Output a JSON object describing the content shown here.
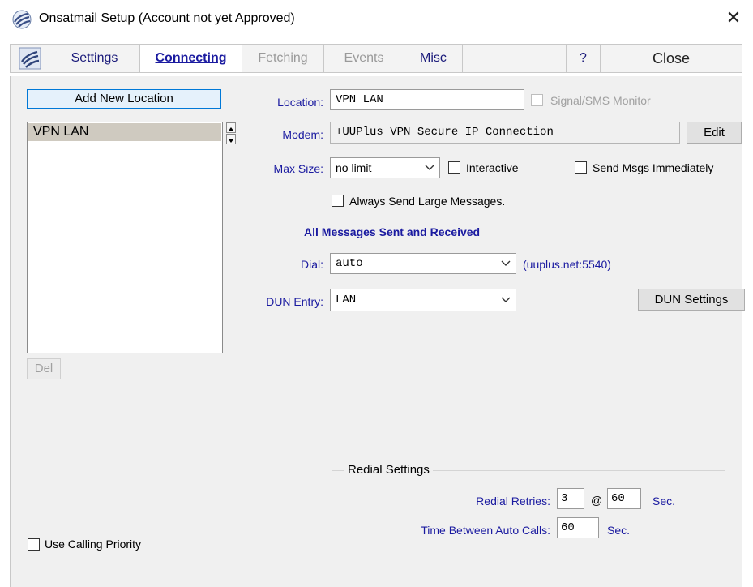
{
  "window": {
    "title": "Onsatmail Setup  (Account not yet Approved)",
    "close_glyph": "✕"
  },
  "tabs": [
    {
      "label": "Settings",
      "state": "normal"
    },
    {
      "label": "Connecting",
      "state": "active"
    },
    {
      "label": "Fetching",
      "state": "disabled"
    },
    {
      "label": "Events",
      "state": "disabled"
    },
    {
      "label": "Misc",
      "state": "normal"
    },
    {
      "label": "",
      "state": "blank"
    },
    {
      "label": "?",
      "state": "normal"
    },
    {
      "label": "Close",
      "state": "normal"
    }
  ],
  "locations": {
    "add_button": "Add New Location",
    "items": [
      "VPN LAN"
    ],
    "delete_button": "Del",
    "use_calling_priority": "Use Calling Priority"
  },
  "form": {
    "location_label": "Location:",
    "location_value": "VPN LAN",
    "signal_monitor_label": "Signal/SMS Monitor",
    "modem_label": "Modem:",
    "modem_value": "+UUPlus VPN Secure IP Connection",
    "edit_button": "Edit",
    "max_size_label": "Max Size:",
    "max_size_value": "no limit",
    "interactive_label": "Interactive",
    "send_immediately_label": "Send Msgs Immediately",
    "always_send_large_label": "Always Send Large Messages.",
    "messages_heading": "All Messages Sent and Received",
    "dial_label": "Dial:",
    "dial_value": "auto",
    "dial_host": "(uuplus.net:5540)",
    "dun_entry_label": "DUN Entry:",
    "dun_entry_value": "LAN",
    "dun_settings_button": "DUN Settings"
  },
  "redial": {
    "title": "Redial Settings",
    "retries_label": "Redial Retries:",
    "retries_value": "3",
    "at_symbol": "@",
    "retry_seconds": "60",
    "sec_label": "Sec.",
    "between_label": "Time Between Auto Calls:",
    "between_value": "60",
    "between_sec_label": "Sec."
  },
  "colors": {
    "accent": "#1a1aa0",
    "disabled": "#9a9a9a",
    "selection": "#cfcac0"
  },
  "icons": {
    "app": "onsat-satellite-icon",
    "caret": "chevron-down-icon"
  }
}
